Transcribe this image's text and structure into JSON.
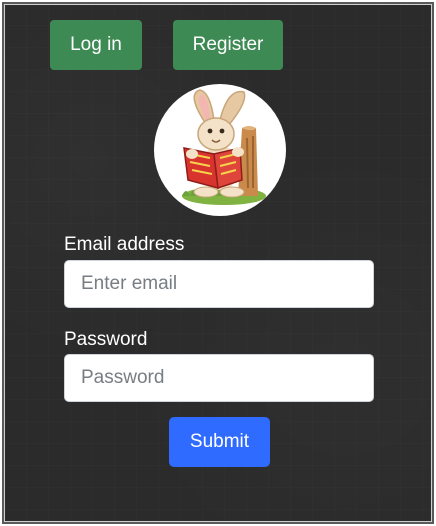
{
  "nav": {
    "login_label": "Log in",
    "register_label": "Register"
  },
  "avatar": {
    "icon": "bunny-reading-book-illustration"
  },
  "form": {
    "email_label": "Email address",
    "email_placeholder": "Enter email",
    "email_value": "",
    "password_label": "Password",
    "password_placeholder": "Password",
    "password_value": "",
    "submit_label": "Submit"
  },
  "colors": {
    "background": "#2b2b2b",
    "nav_button": "#3e8a55",
    "submit_button": "#2f6bff"
  }
}
